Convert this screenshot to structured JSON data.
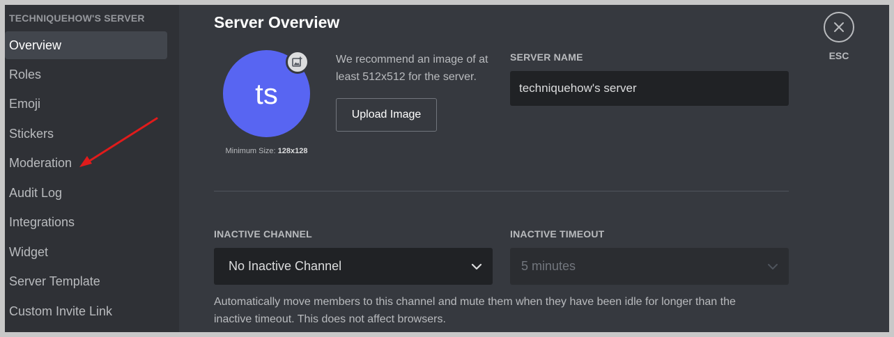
{
  "sidebar": {
    "header": "TECHNIQUEHOW'S SERVER",
    "items": [
      {
        "label": "Overview"
      },
      {
        "label": "Roles"
      },
      {
        "label": "Emoji"
      },
      {
        "label": "Stickers"
      },
      {
        "label": "Moderation"
      },
      {
        "label": "Audit Log"
      },
      {
        "label": "Integrations"
      },
      {
        "label": "Widget"
      },
      {
        "label": "Server Template"
      },
      {
        "label": "Custom Invite Link"
      }
    ]
  },
  "main": {
    "title": "Server Overview",
    "avatar": {
      "initials": "ts",
      "badge_icon": "add-image-icon",
      "color": "#5865f2"
    },
    "min_size_prefix": "Minimum Size:",
    "min_size_value": "128x128",
    "recommend_text": "We recommend an image of at least 512x512 for the server.",
    "upload_button": "Upload Image",
    "server_name_label": "SERVER NAME",
    "server_name_value": "techniquehow's server",
    "inactive_channel_label": "INACTIVE CHANNEL",
    "inactive_channel_value": "No Inactive Channel",
    "inactive_timeout_label": "INACTIVE TIMEOUT",
    "inactive_timeout_value": "5 minutes",
    "help_text": "Automatically move members to this channel and mute them when they have been idle for longer than the inactive timeout. This does not affect browsers."
  },
  "close": {
    "label": "ESC",
    "icon": "close-icon"
  },
  "annotation": {
    "type": "red-arrow",
    "points_to": "Moderation",
    "color": "#e01b1b"
  }
}
